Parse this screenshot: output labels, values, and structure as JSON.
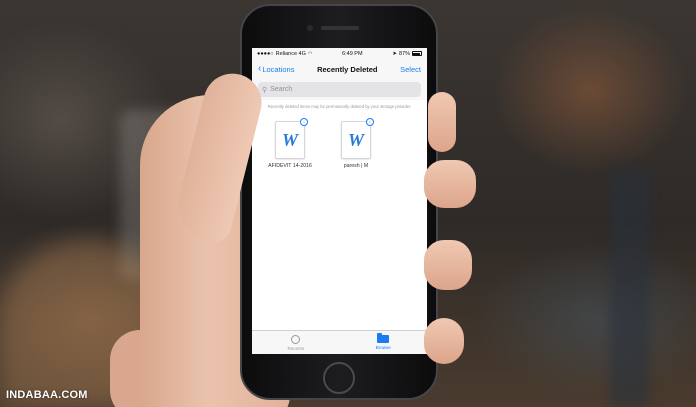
{
  "status_bar": {
    "carrier": "Reliance 4G",
    "time": "6:49 PM",
    "battery": "87%"
  },
  "nav": {
    "back_label": "Locations",
    "title": "Recently Deleted",
    "select_label": "Select"
  },
  "search": {
    "placeholder": "Search"
  },
  "info_text": "Recently deleted items may be permanently deleted by your storage provider.",
  "files": [
    {
      "name": "AFIDEVIT 14-2016",
      "icon": "word-document-icon"
    },
    {
      "name": "paresh | M",
      "icon": "word-document-icon"
    }
  ],
  "tabs": [
    {
      "label": "Recents",
      "icon": "clock-icon",
      "active": false
    },
    {
      "label": "Browse",
      "icon": "folder-icon",
      "active": true
    }
  ],
  "colors": {
    "accent": "#1a7cf5",
    "word_blue": "#2b7bd6"
  },
  "watermark": "INDABAA.COM"
}
